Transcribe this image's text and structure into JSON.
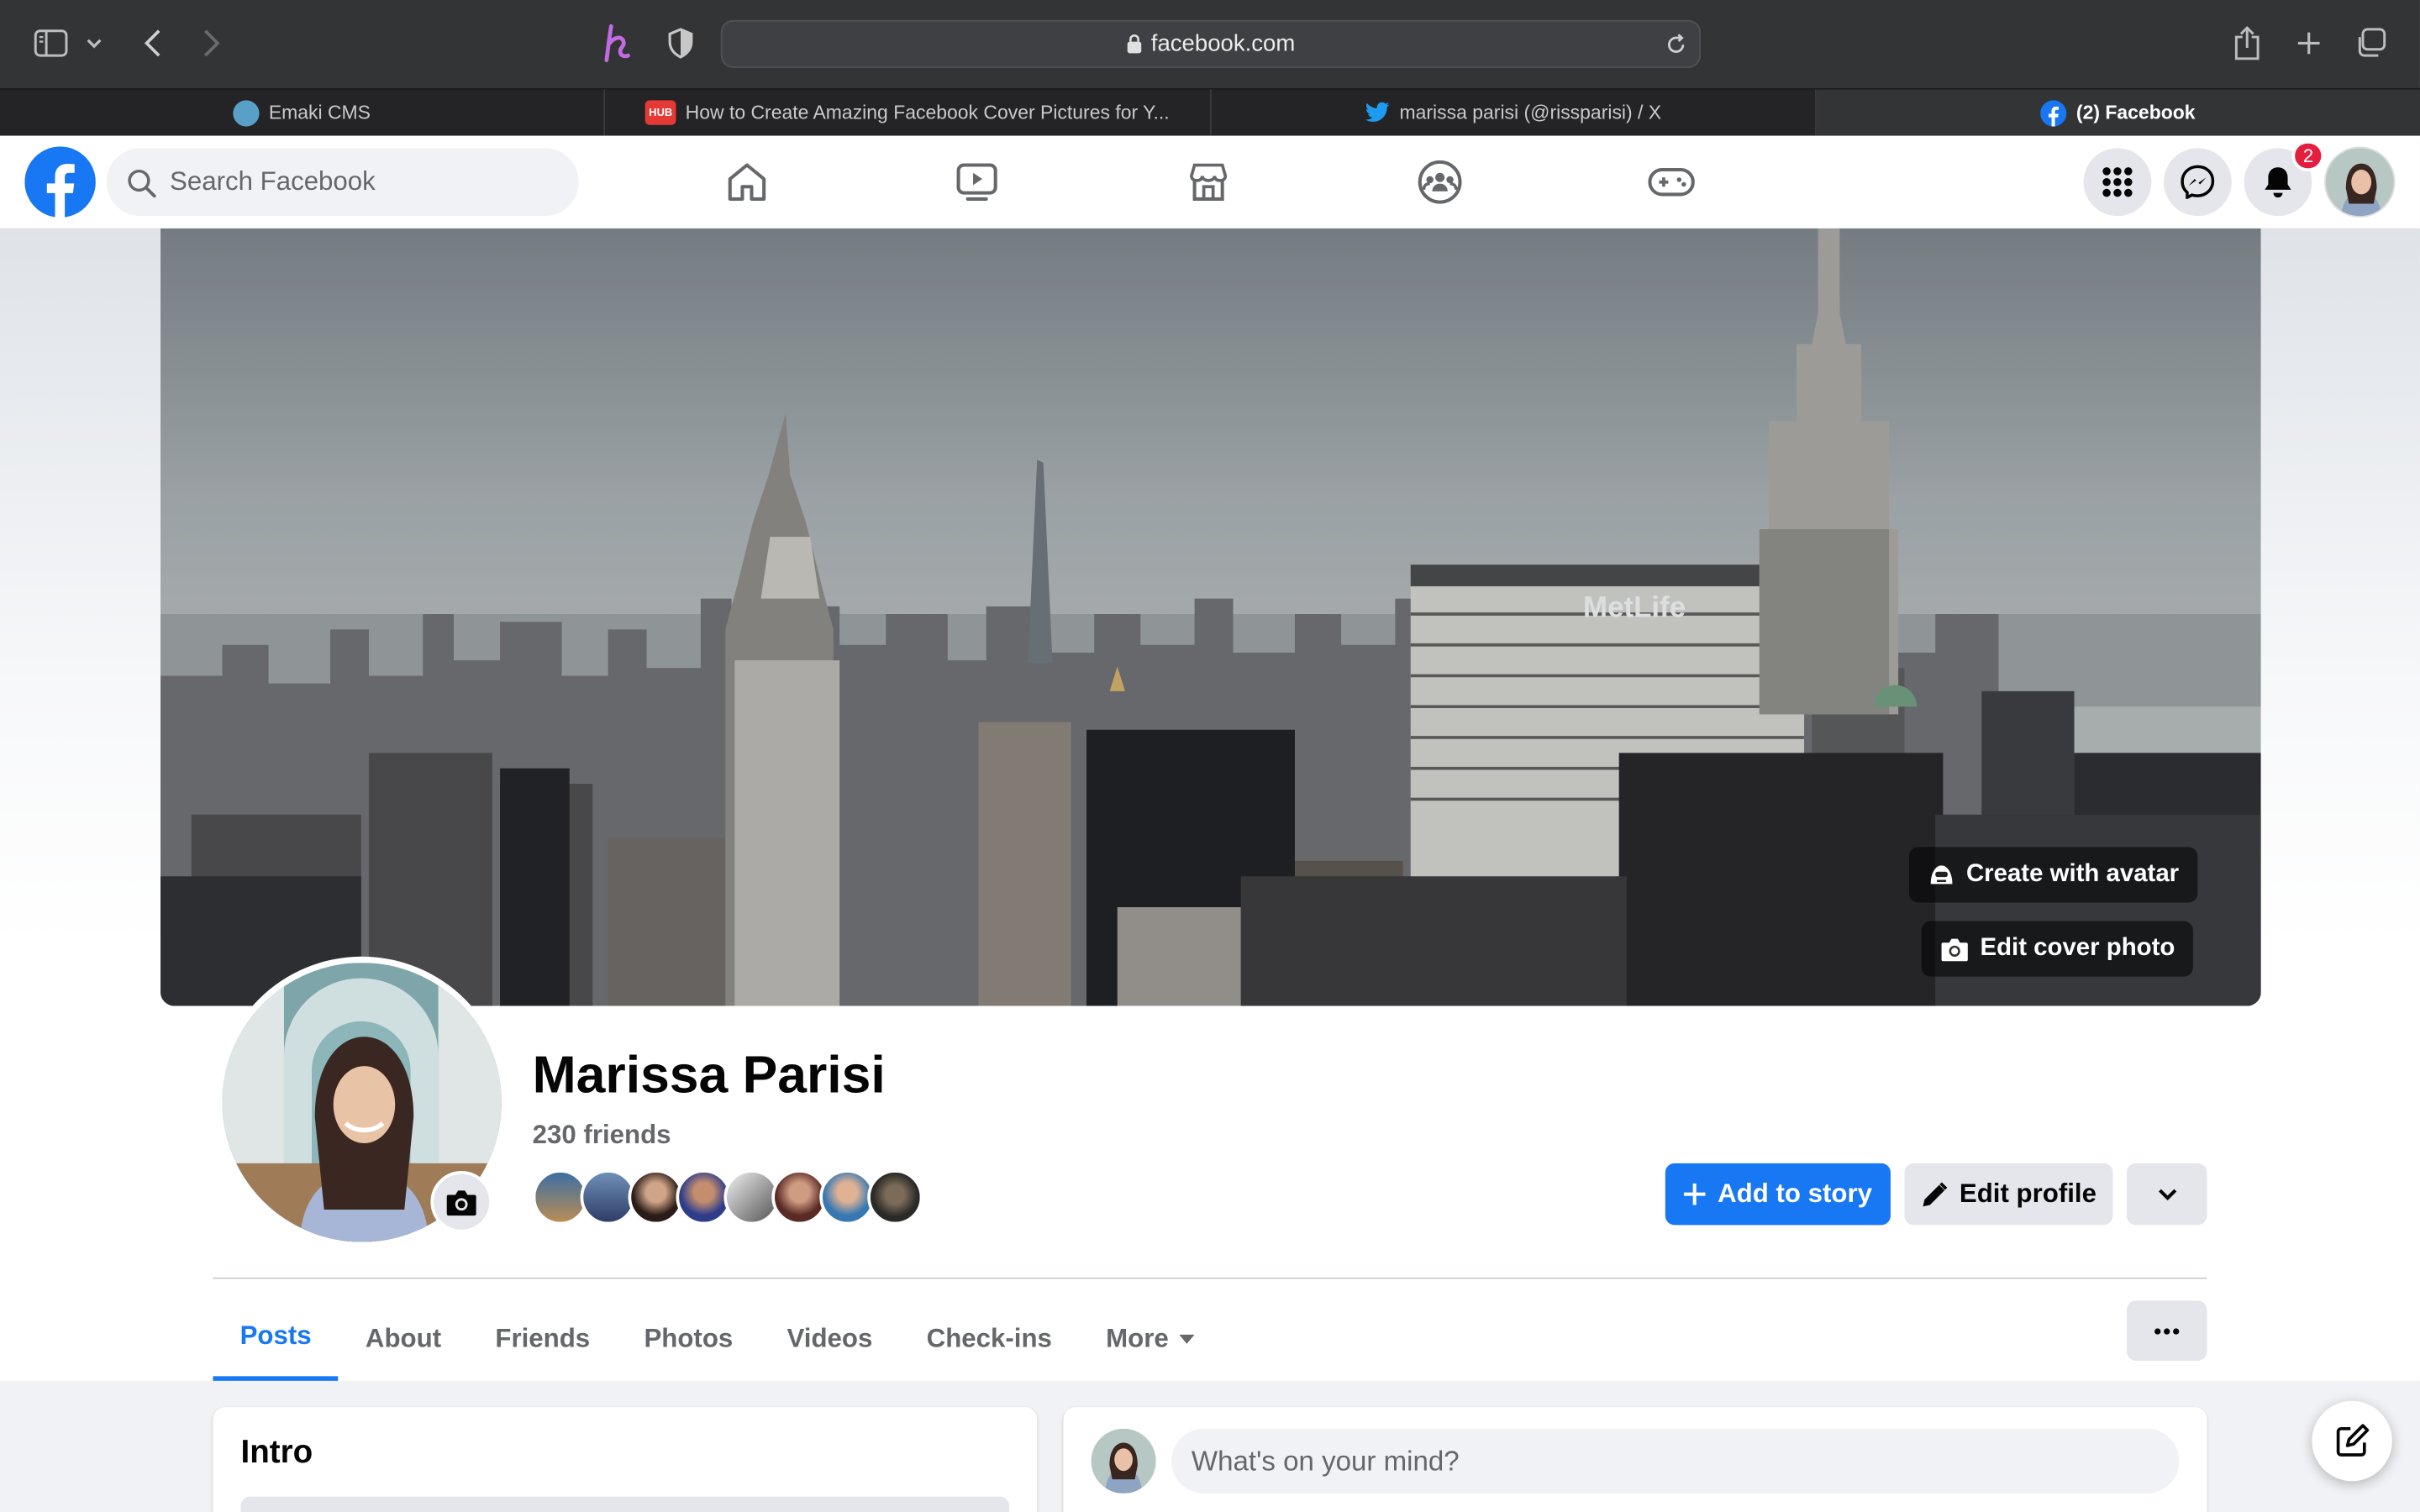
{
  "browser": {
    "url": "facebook.com",
    "tabs": [
      {
        "title": "Emaki CMS",
        "icon": "emaki-favicon-icon"
      },
      {
        "title": "How to Create Amazing Facebook Cover Pictures for Y...",
        "icon": "hub-favicon-icon"
      },
      {
        "title": "marissa parisi (@rissparisi) / X",
        "icon": "twitter-favicon-icon"
      },
      {
        "title": "(2) Facebook",
        "icon": "facebook-favicon-icon",
        "active": true
      }
    ]
  },
  "header": {
    "search_placeholder": "Search Facebook",
    "nav_icons": [
      "home-icon",
      "watch-icon",
      "marketplace-icon",
      "groups-icon",
      "gaming-icon"
    ],
    "notification_count": "2"
  },
  "cover": {
    "sign_text": "MetLife",
    "create_avatar_label": "Create with avatar",
    "edit_cover_label": "Edit cover photo"
  },
  "profile": {
    "name": "Marissa Parisi",
    "friends_count": "230 friends",
    "friend_avatar_count": 8,
    "add_story_label": "Add to story",
    "edit_profile_label": "Edit profile"
  },
  "tabs": [
    "Posts",
    "About",
    "Friends",
    "Photos",
    "Videos",
    "Check-ins",
    "More"
  ],
  "intro": {
    "title": "Intro"
  },
  "composer": {
    "placeholder": "What's on your mind?"
  },
  "colors": {
    "brand": "#1877f2",
    "badge": "#e41e3f"
  }
}
